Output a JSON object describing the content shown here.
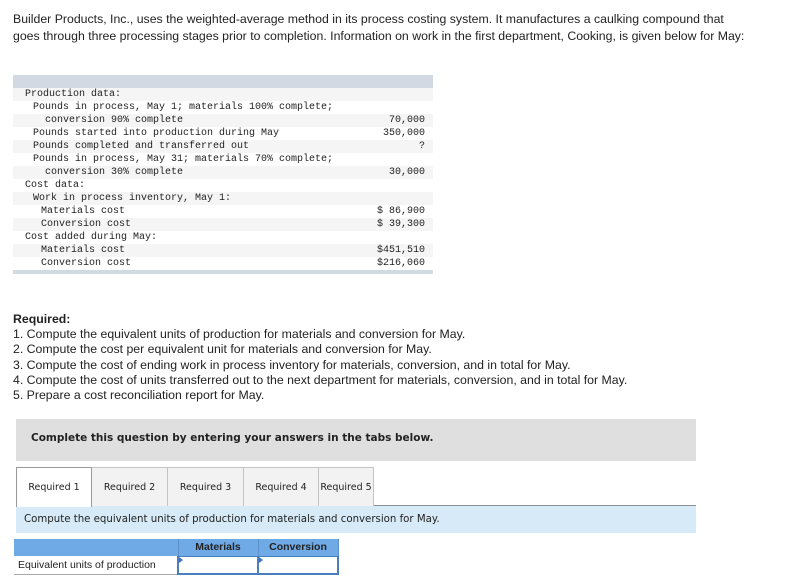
{
  "intro": "Builder Products, Inc., uses the weighted-average method in its process costing system. It manufactures a caulking compound that goes through three processing stages prior to completion. Information on work in the first department, Cooking, is given below for May:",
  "data_table": {
    "rows": [
      {
        "label": "Production data:",
        "value": "",
        "indent": 0
      },
      {
        "label": "Pounds in process, May 1; materials 100% complete;",
        "value": "",
        "indent": 1
      },
      {
        "label": "conversion 90% complete",
        "value": "70,000",
        "indent": 3
      },
      {
        "label": "Pounds started into production during May",
        "value": "350,000",
        "indent": 1
      },
      {
        "label": "Pounds completed and transferred out",
        "value": "?",
        "indent": 1
      },
      {
        "label": "Pounds in process, May 31; materials 70% complete;",
        "value": "",
        "indent": 1
      },
      {
        "label": "conversion 30% complete",
        "value": "30,000",
        "indent": 3
      },
      {
        "label": "Cost data:",
        "value": "",
        "indent": 0
      },
      {
        "label": "Work in process inventory, May 1:",
        "value": "",
        "indent": 1
      },
      {
        "label": "Materials cost",
        "value": "$ 86,900",
        "indent": 2
      },
      {
        "label": "Conversion cost",
        "value": "$ 39,300",
        "indent": 2
      },
      {
        "label": "Cost added during May:",
        "value": "",
        "indent": 0
      },
      {
        "label": "Materials cost",
        "value": "$451,510",
        "indent": 2
      },
      {
        "label": "Conversion cost",
        "value": "$216,060",
        "indent": 2
      }
    ]
  },
  "required": {
    "title": "Required:",
    "items": [
      "1. Compute the equivalent units of production for materials and conversion for May.",
      "2. Compute the cost per equivalent unit for materials and conversion for May.",
      "3. Compute the cost of ending work in process inventory for materials, conversion, and in total for May.",
      "4. Compute the cost of units transferred out to the next department for materials, conversion, and in total for May.",
      "5. Prepare a cost reconciliation report for May."
    ]
  },
  "instruction": "Complete this question by entering your answers in the tabs below.",
  "tabs": [
    {
      "label": "Required 1",
      "active": true
    },
    {
      "label": "Required 2",
      "active": false
    },
    {
      "label": "Required 3",
      "active": false
    },
    {
      "label": "Required 4",
      "active": false
    },
    {
      "label": "Required 5",
      "active": false
    }
  ],
  "tab_prompt": "Compute the equivalent units of production for materials and conversion for May.",
  "answer_table": {
    "headers": [
      "",
      "Materials",
      "Conversion"
    ],
    "row_label": "Equivalent units of production",
    "materials_value": "",
    "conversion_value": ""
  },
  "colors": {
    "table_band": "#d3d9e3",
    "instruction_bg": "#dfdfdf",
    "prompt_bg": "#d7eaf8",
    "answer_header": "#6fa9e6",
    "input_border": "#4a7fbf"
  }
}
